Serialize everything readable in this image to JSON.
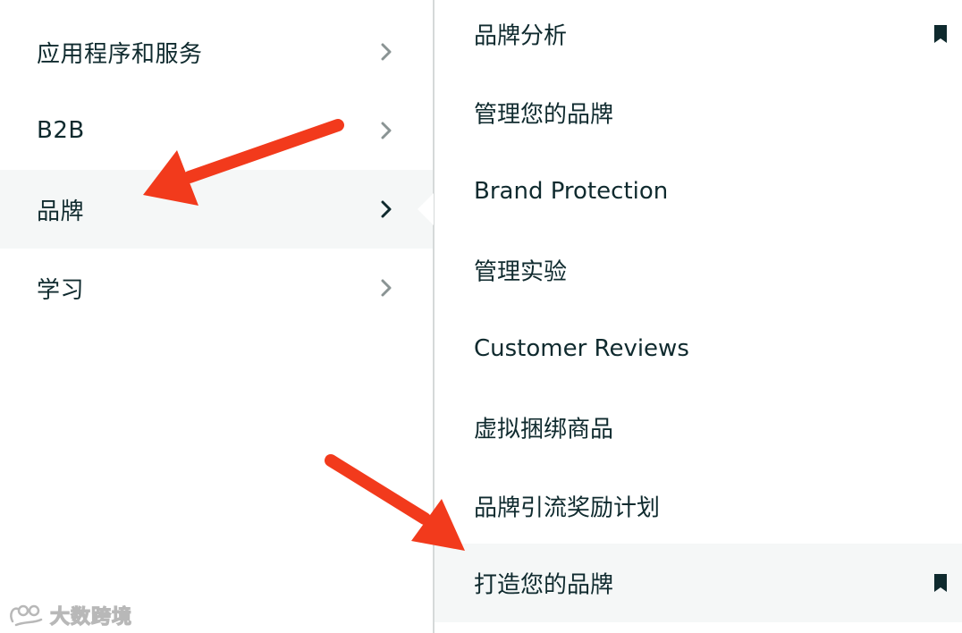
{
  "left_menu": {
    "items": [
      {
        "label": "应用程序和服务",
        "active": false
      },
      {
        "label": "B2B",
        "active": false
      },
      {
        "label": "品牌",
        "active": true
      },
      {
        "label": "学习",
        "active": false
      }
    ]
  },
  "right_menu": {
    "items": [
      {
        "label": "品牌分析",
        "bookmarked": true,
        "highlighted": false
      },
      {
        "label": "管理您的品牌",
        "bookmarked": false,
        "highlighted": false
      },
      {
        "label": "Brand Protection",
        "bookmarked": false,
        "highlighted": false
      },
      {
        "label": "管理实验",
        "bookmarked": false,
        "highlighted": false
      },
      {
        "label": "Customer Reviews",
        "bookmarked": false,
        "highlighted": false
      },
      {
        "label": "虚拟捆绑商品",
        "bookmarked": false,
        "highlighted": false
      },
      {
        "label": "品牌引流奖励计划",
        "bookmarked": false,
        "highlighted": false
      },
      {
        "label": "打造您的品牌",
        "bookmarked": true,
        "highlighted": true
      }
    ]
  },
  "watermark": {
    "text": "大数跨境"
  },
  "colors": {
    "text": "#0f2a2e",
    "chevron_inactive": "#8a9494",
    "chevron_active": "#0f2a2e",
    "active_bg": "#f5f7f7",
    "divider": "#d5d9d9",
    "arrow": "#f23a1c"
  },
  "icons": {
    "chevron": "chevron-right-icon",
    "bookmark": "bookmark-icon"
  }
}
